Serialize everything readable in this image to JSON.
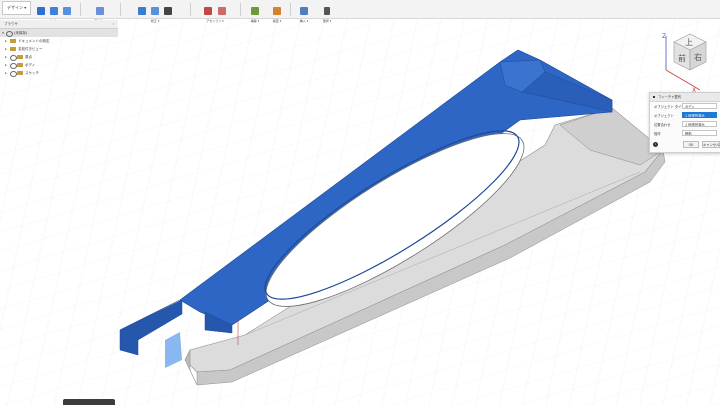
{
  "toolbar": {
    "workspace_label": "デザイン ▾",
    "groups": [
      {
        "label": "作成 ▾",
        "color": "#2f6fd0"
      },
      {
        "label": "自動化 ▾",
        "color": "#6a8fd6"
      },
      {
        "label": "修正 ▾",
        "color": "#3a7bd5"
      },
      {
        "label": "アセンブリ ▾",
        "color": "#c24747"
      },
      {
        "label": "構築 ▾",
        "color": "#6b9a3b"
      },
      {
        "label": "検査 ▾",
        "color": "#d4822d"
      },
      {
        "label": "挿入 ▾",
        "color": "#4f7fbf"
      },
      {
        "label": "選択 ▾",
        "color": "#555555"
      }
    ]
  },
  "browser": {
    "title": "ブラウザ",
    "items": [
      {
        "label": "(未保存)",
        "level": 0
      },
      {
        "label": "ドキュメントの設定",
        "level": 1
      },
      {
        "label": "名前付きビュー",
        "level": 1
      },
      {
        "label": "原点",
        "level": 1
      },
      {
        "label": "ボディ",
        "level": 1
      },
      {
        "label": "スケッチ",
        "level": 1
      }
    ]
  },
  "viewcube": {
    "top_face": "上",
    "front_face": "前",
    "right_face": "右",
    "axis_z": "Z",
    "axis_x": "X"
  },
  "dialog": {
    "title": "フィーチャ整列",
    "rows": [
      {
        "label": "オブジェクト タイプ",
        "value": "ボディ",
        "selected": false
      },
      {
        "label": "オブジェクト",
        "value": "1 個選択済み",
        "selected": true
      },
      {
        "label": "位置合わせ",
        "value": "1 個選択済み",
        "selected": false
      },
      {
        "label": "操作",
        "value": "移動",
        "selected": false
      }
    ],
    "ok_label": "OK",
    "cancel_label": "キャンセル"
  },
  "colors": {
    "selected_body": "#2d66c4",
    "body_gray": "#d9d9d9",
    "grid": "#e6e9ee",
    "origin_plane": "#6ba6ee"
  }
}
